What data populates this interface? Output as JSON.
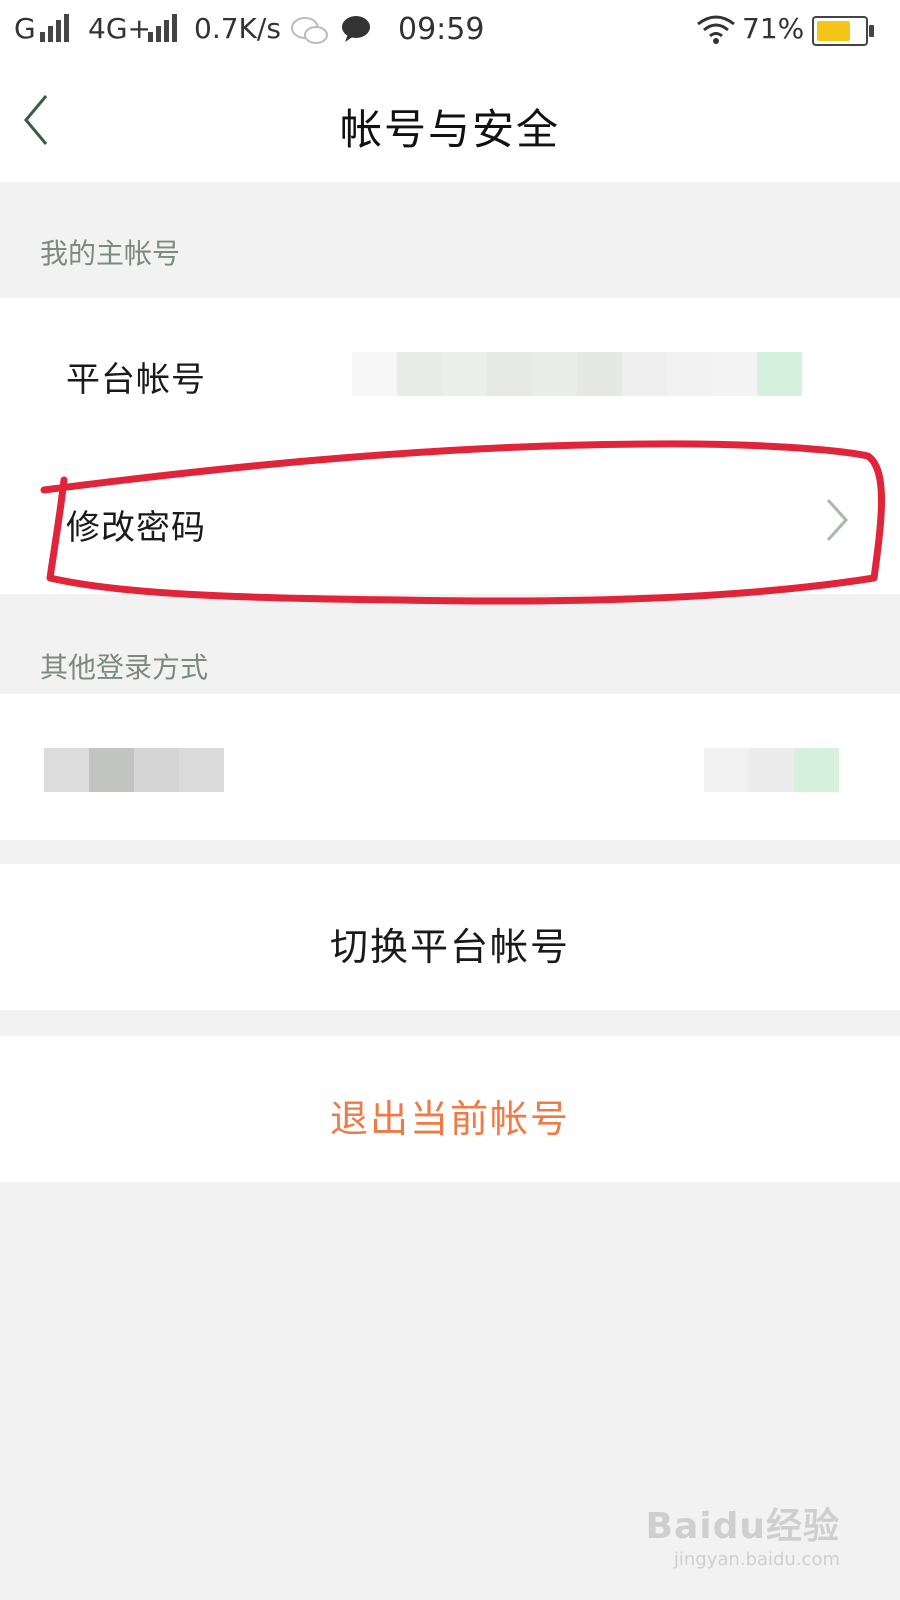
{
  "status_bar": {
    "carrier1": "G",
    "network": "4G+",
    "speed": "0.7K/s",
    "time": "09:59",
    "battery": "71%",
    "battery_level": 0.71,
    "icons": [
      "signal-icon",
      "wechat-icon",
      "message-bubble-icon",
      "wifi-icon",
      "battery-icon"
    ]
  },
  "header": {
    "title": "帐号与安全",
    "back_icon": "chevron-left-icon"
  },
  "sections": {
    "main_account_label": "我的主帐号",
    "platform_account_label": "平台帐号",
    "change_password_label": "修改密码",
    "other_login_label": "其他登录方式"
  },
  "actions": {
    "switch_account": "切换平台帐号",
    "logout": "退出当前帐号"
  },
  "watermark": {
    "logo": "Baidu经验",
    "url": "jingyan.baidu.com"
  },
  "colors": {
    "accent_green": "#3a9a5b",
    "logout_orange": "#ef7a45",
    "annotation_red": "#e0243a"
  }
}
